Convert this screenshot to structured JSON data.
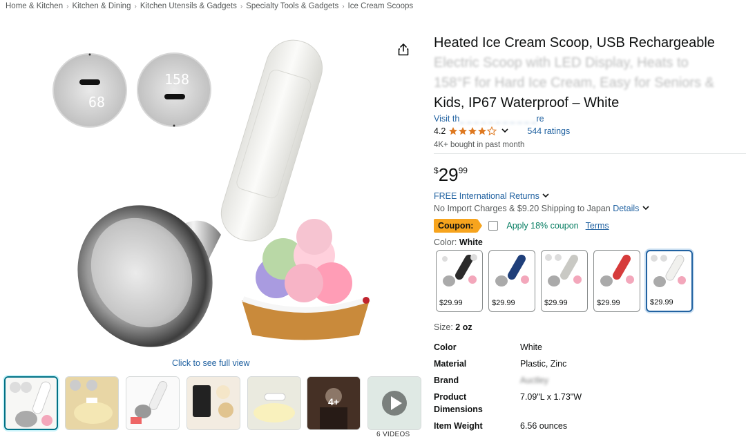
{
  "breadcrumb": [
    "Home & Kitchen",
    "Kitchen & Dining",
    "Kitchen Utensils & Gadgets",
    "Specialty Tools & Gadgets",
    "Ice Cream Scoops"
  ],
  "breadcrumb_sep": "›",
  "gallery": {
    "main_screen_left": "68",
    "main_screen_right": "158",
    "see_full_view": "Click to see full view",
    "more_count": "4+",
    "videos_label": "6 VIDEOS"
  },
  "product": {
    "title_lines": [
      "Heated Ice Cream Scoop, USB Rechargeable",
      "Electric Scoop with LED Display, Heats to",
      "158°F for Hard Ice Cream, Easy for Seniors &",
      "Kids, IP67 Waterproof – White"
    ],
    "store_link_start": "Visit th",
    "store_link_end": "re",
    "rating_value": "4.2",
    "ratings_count": "544 ratings",
    "bought": "4K+ bought in past month",
    "price_symbol": "$",
    "price_whole": "29",
    "price_fraction": "99",
    "intl_returns": "FREE International Returns",
    "shipping_text": "No Import Charges & $9.20 Shipping to Japan",
    "shipping_details": "Details",
    "coupon_badge": "Coupon:",
    "coupon_apply": "Apply 18% coupon",
    "coupon_terms": "Terms",
    "color_label": "Color:",
    "color_value": "White",
    "size_label": "Size:",
    "size_value": "2 oz"
  },
  "swatches": [
    {
      "price": "$29.99",
      "color": "#2b2b2b"
    },
    {
      "price": "$29.99",
      "color": "#1f3f7a"
    },
    {
      "price": "$29.99",
      "color": "#c9c9c4"
    },
    {
      "price": "$29.99",
      "color": "#d63b3b"
    },
    {
      "price": "$29.99",
      "color": "#f1f1ee"
    }
  ],
  "specs": [
    {
      "key": "Color",
      "value": "White"
    },
    {
      "key": "Material",
      "value": "Plastic, Zinc"
    },
    {
      "key": "Brand",
      "value": "Auctley"
    },
    {
      "key": "Product Dimensions",
      "value": "7.09\"L x 1.73\"W"
    },
    {
      "key": "Item Weight",
      "value": "6.56 ounces"
    }
  ],
  "colors": {
    "link": "#2162a1",
    "star": "#de7921",
    "coupon": "#f7a41d",
    "apply_green": "#067d62"
  }
}
